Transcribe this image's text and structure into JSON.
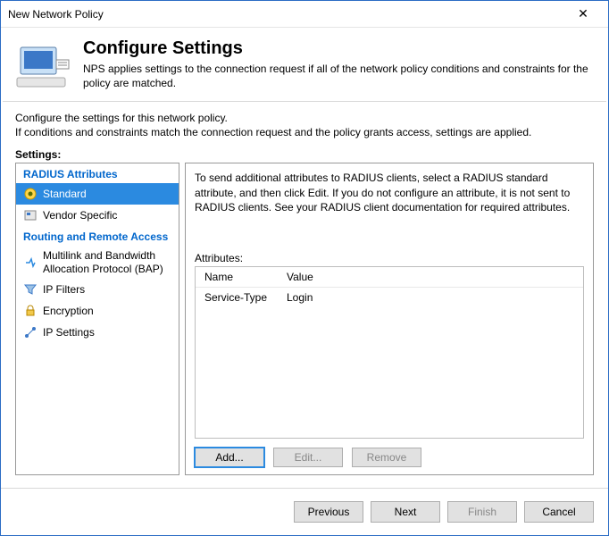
{
  "window": {
    "title": "New Network Policy",
    "close": "✕"
  },
  "header": {
    "title": "Configure Settings",
    "desc": "NPS applies settings to the connection request if all of the network policy conditions and constraints for the policy are matched."
  },
  "intro": {
    "line1": "Configure the settings for this network policy.",
    "line2": "If conditions and constraints match the connection request and the policy grants access, settings are applied."
  },
  "settings_label": "Settings:",
  "sidebar": {
    "group_radius": "RADIUS Attributes",
    "standard": "Standard",
    "vendor": "Vendor Specific",
    "group_rra": "Routing and Remote Access",
    "bap": "Multilink and Bandwidth Allocation Protocol (BAP)",
    "ipfilters": "IP Filters",
    "encryption": "Encryption",
    "ipsettings": "IP Settings"
  },
  "content": {
    "desc": "To send additional attributes to RADIUS clients, select a RADIUS standard attribute, and then click Edit. If you do not configure an attribute, it is not sent to RADIUS clients. See your RADIUS client documentation for required attributes.",
    "attr_label": "Attributes:",
    "columns": {
      "name": "Name",
      "value": "Value"
    },
    "rows": [
      {
        "name": "Service-Type",
        "value": "Login"
      }
    ],
    "buttons": {
      "add": "Add...",
      "edit": "Edit...",
      "remove": "Remove"
    }
  },
  "footer": {
    "previous": "Previous",
    "next": "Next",
    "finish": "Finish",
    "cancel": "Cancel"
  }
}
